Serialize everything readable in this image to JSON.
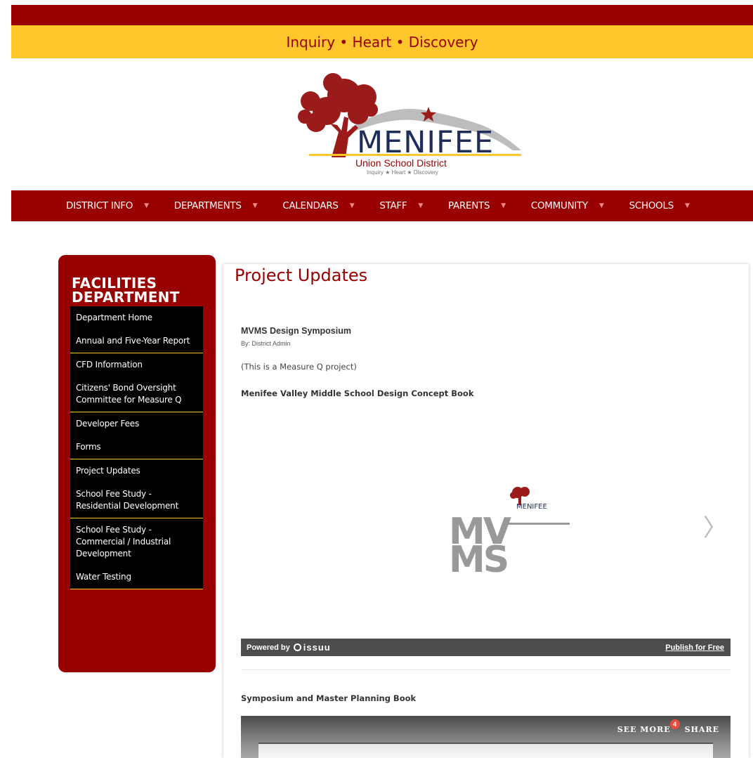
{
  "header": {
    "tagline": "Inquiry • Heart • Discovery"
  },
  "logo": {
    "name": "MENIFEE",
    "subtitle": "Union School District",
    "tag": "Inquiry ★ Heart ★ Discovery",
    "colors": {
      "tree": "#9b1b1b",
      "text": "#1e2d5a",
      "accent": "#ffc72c"
    }
  },
  "nav": {
    "items": [
      {
        "label": "DISTRICT INFO"
      },
      {
        "label": "DEPARTMENTS"
      },
      {
        "label": "CALENDARS"
      },
      {
        "label": "STAFF"
      },
      {
        "label": "PARENTS"
      },
      {
        "label": "COMMUNITY"
      },
      {
        "label": "SCHOOLS"
      }
    ]
  },
  "sidebar": {
    "title_line1": "FACILITIES",
    "title_line2": "DEPARTMENT",
    "items": [
      {
        "label": "Department Home"
      },
      {
        "label": "Annual and Five-Year Report"
      },
      {
        "label": "CFD Information"
      },
      {
        "label": "Citizens' Bond Oversight Committee for Measure Q"
      },
      {
        "label": "Developer Fees"
      },
      {
        "label": "Forms"
      },
      {
        "label": "Project Updates"
      },
      {
        "label": "School Fee Study - Residential Development"
      },
      {
        "label": "School Fee Study - Commercial / Industrial Development"
      },
      {
        "label": "Water Testing"
      }
    ]
  },
  "main": {
    "page_title": "Project Updates",
    "post": {
      "title": "MVMS Design Symposium",
      "byline": "By: District Admin",
      "note": "(This is a Measure Q project)",
      "book1_heading": "Menifee Valley Middle School Design Concept Book",
      "book2_heading": "Symposium and Master Planning Book"
    },
    "viewer": {
      "cover_text_line1": "MV",
      "cover_text_line2": "MS",
      "cover_brand": "MENIFEE",
      "next_icon": "chevron-right"
    },
    "issuu": {
      "powered_by": "Powered by",
      "logo_text": "issuu",
      "publish_link": "Publish for Free"
    },
    "embed2": {
      "see_more": "SEE MORE",
      "see_more_count": "4",
      "share": "SHARE"
    }
  },
  "colors": {
    "brand_red": "#990000",
    "brand_gold": "#ffc72c"
  }
}
